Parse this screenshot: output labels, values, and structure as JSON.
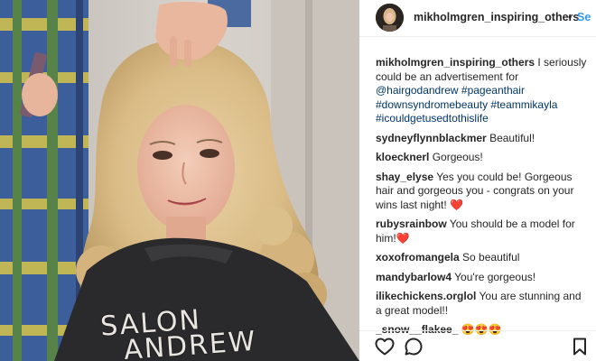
{
  "post": {
    "username": "mikholmgren_inspiring_others",
    "follow_separator": "•",
    "follow_label": "Se",
    "cape_text_line1": "SALON",
    "cape_text_line2": "ANDREW"
  },
  "caption": {
    "username": "mikholmgren_inspiring_others",
    "text": "I seriously could be an advertisement for",
    "tags": "@hairgodandrew #pageanthair #downsyndromebeauty #teammikayla #icouldgetusedtothislife"
  },
  "comments": [
    {
      "username": "sydneyflynnblackmer",
      "text": "Beautiful!",
      "emoji": ""
    },
    {
      "username": "kloecknerl",
      "text": "Gorgeous!",
      "emoji": ""
    },
    {
      "username": "shay_elyse",
      "text": "Yes you could be! Gorgeous hair and gorgeous you - congrats on your wins last night!",
      "emoji": "❤️"
    },
    {
      "username": "rubysrainbow",
      "text": "You should be a model for him!",
      "emoji": "❤️"
    },
    {
      "username": "xoxofromangela",
      "text": "So beautiful",
      "emoji": ""
    },
    {
      "username": "mandybarlow4",
      "text": "You're gorgeous!",
      "emoji": ""
    },
    {
      "username": "ilikechickens.orglol",
      "text": "You are stunning and a great model!!",
      "emoji": ""
    },
    {
      "username": "_snow__flakee_",
      "text": "",
      "emoji": "😍😍😍"
    }
  ],
  "icons": {
    "like": "heart-icon",
    "comment": "comment-icon",
    "save": "bookmark-icon"
  },
  "colors": {
    "link_blue": "#3897f0",
    "text": "#262626",
    "heart": "#ed4956"
  }
}
